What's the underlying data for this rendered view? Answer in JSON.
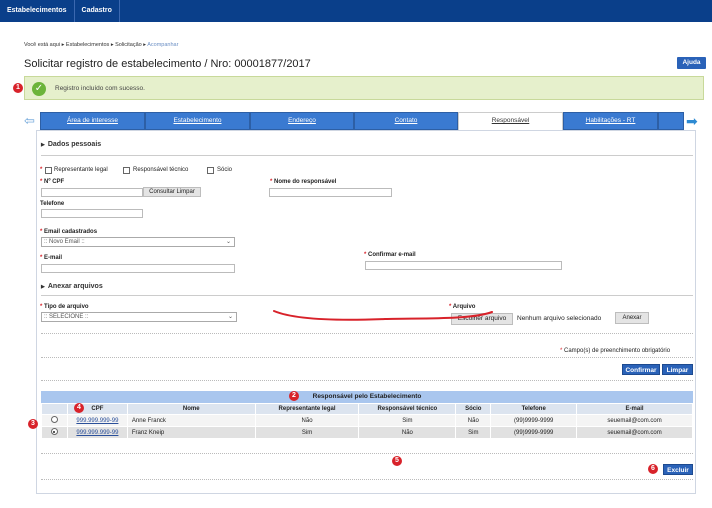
{
  "topbar": {
    "items": [
      "Estabelecimentos",
      "Cadastro"
    ]
  },
  "breadcrumb": {
    "prefix": "Você está aqui ▸ Estabelecimentos ▸ Solicitação ▸ ",
    "current": "Acompanhar"
  },
  "page": {
    "title": "Solicitar registro de estabelecimento / Nro: 00001877/2017",
    "help_label": "Ajuda"
  },
  "success": {
    "message": "Registro incluído com sucesso."
  },
  "callouts": [
    "1",
    "2",
    "3",
    "4",
    "5",
    "6"
  ],
  "tabs": [
    {
      "label": "Área de interesse"
    },
    {
      "label": "Estabelecimento"
    },
    {
      "label": "Endereço"
    },
    {
      "label": "Contato"
    },
    {
      "label": "Responsável"
    },
    {
      "label": "Habilitações - RT"
    }
  ],
  "personal": {
    "section_title": "Dados pessoais",
    "roles": [
      "Representante legal",
      "Responsável técnico",
      "Sócio"
    ],
    "cpf_label": "Nº CPF",
    "consultar_label": "Consultar",
    "limpar_label": "Limpar",
    "nome_label": "Nome do responsável",
    "telefone_label": "Telefone",
    "email_cadastrados_label": "Email cadastrados",
    "email_cadastrados_value": ":: Novo Email ::",
    "email_label": "E-mail",
    "confirmar_email_label": "Confirmar e-mail"
  },
  "files": {
    "section_title": "Anexar arquivos",
    "tipo_label": "Tipo de arquivo",
    "tipo_value": ":: SELECIONE ::",
    "arquivo_label": "Arquivo",
    "escolher_label": "Escolher arquivo",
    "nenhum_label": "Nenhum arquivo selecionado",
    "anexar_label": "Anexar"
  },
  "required_note": "Campo(s) de preenchimento obrigatório",
  "actions": {
    "confirmar": "Confirmar",
    "limpar": "Limpar",
    "excluir": "Excluir"
  },
  "grid": {
    "title": "Responsável pelo Estabelecimento",
    "columns": [
      "",
      "CPF",
      "Nome",
      "Representante legal",
      "Responsável técnico",
      "Sócio",
      "Telefone",
      "E-mail"
    ],
    "rows": [
      {
        "cpf": "999.999.999-99",
        "nome": "Anne Franck",
        "rep": "Não",
        "resp": "Sim",
        "socio": "Não",
        "telefone": "(99)9999-9999",
        "email": "seuemail@com.com"
      },
      {
        "cpf": "999.999.999-99",
        "nome": "Franz Kneip",
        "rep": "Sim",
        "resp": "Não",
        "socio": "Sim",
        "telefone": "(99)9999-9999",
        "email": "seuemail@com.com"
      }
    ]
  },
  "colors": {
    "nav": "#0a3f8a",
    "tab": "#3a7ad1",
    "button": "#2a62b8",
    "success_bg": "#e6f0cc",
    "callout": "#d8222a"
  }
}
